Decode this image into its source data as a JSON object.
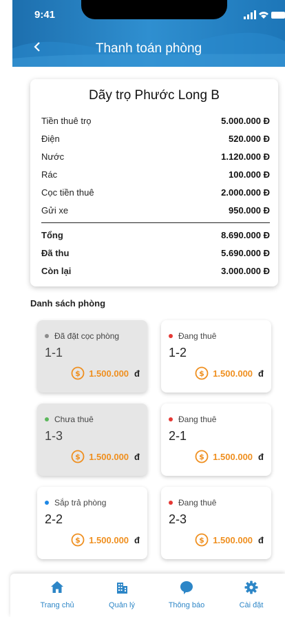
{
  "status_bar": {
    "time": "9:41"
  },
  "header": {
    "title": "Thanh toán phòng"
  },
  "summary": {
    "title": "Dãy trọ Phước Long B",
    "items": [
      {
        "label": "Tiền thuê trọ",
        "value": "5.000.000 Đ"
      },
      {
        "label": "Điện",
        "value": "520.000 Đ"
      },
      {
        "label": "Nước",
        "value": "1.120.000 Đ"
      },
      {
        "label": "Rác",
        "value": "100.000 Đ"
      },
      {
        "label": "Cọc tiền thuê",
        "value": "2.000.000 Đ"
      },
      {
        "label": "Gửi xe",
        "value": "950.000 Đ"
      }
    ],
    "totals": [
      {
        "label": "Tổng",
        "value": "8.690.000 Đ"
      },
      {
        "label": "Đã thu",
        "value": "5.690.000 Đ"
      },
      {
        "label": "Còn lại",
        "value": "3.000.000 Đ"
      }
    ]
  },
  "rooms_section": {
    "title": "Danh sách phòng"
  },
  "rooms": [
    {
      "status": "Đã đặt cọc phòng",
      "status_color": "#8c8c8c",
      "name": "1-1",
      "amount": "1.500.000",
      "unit": "đ",
      "variant": "gray"
    },
    {
      "status": "Đang thuê",
      "status_color": "#e53935",
      "name": "1-2",
      "amount": "1.500.000",
      "unit": "đ",
      "variant": "white"
    },
    {
      "status": "Chưa thuê",
      "status_color": "#5cb85c",
      "name": "1-3",
      "amount": "1.500.000",
      "unit": "đ",
      "variant": "gray"
    },
    {
      "status": "Đang thuê",
      "status_color": "#e53935",
      "name": "2-1",
      "amount": "1.500.000",
      "unit": "đ",
      "variant": "white"
    },
    {
      "status": "Sắp trả phòng",
      "status_color": "#1e88e5",
      "name": "2-2",
      "amount": "1.500.000",
      "unit": "đ",
      "variant": "white"
    },
    {
      "status": "Đang thuê",
      "status_color": "#e53935",
      "name": "2-3",
      "amount": "1.500.000",
      "unit": "đ",
      "variant": "white"
    }
  ],
  "nav": [
    {
      "label": "Trang chủ",
      "icon": "home-icon"
    },
    {
      "label": "Quản lý",
      "icon": "building-icon"
    },
    {
      "label": "Thông báo",
      "icon": "chat-bubble-icon"
    },
    {
      "label": "Cài đặt",
      "icon": "gear-icon"
    }
  ],
  "colors": {
    "brand": "#2d86c7",
    "header_dark": "#1a73b4",
    "accent": "#ef8f1f"
  }
}
